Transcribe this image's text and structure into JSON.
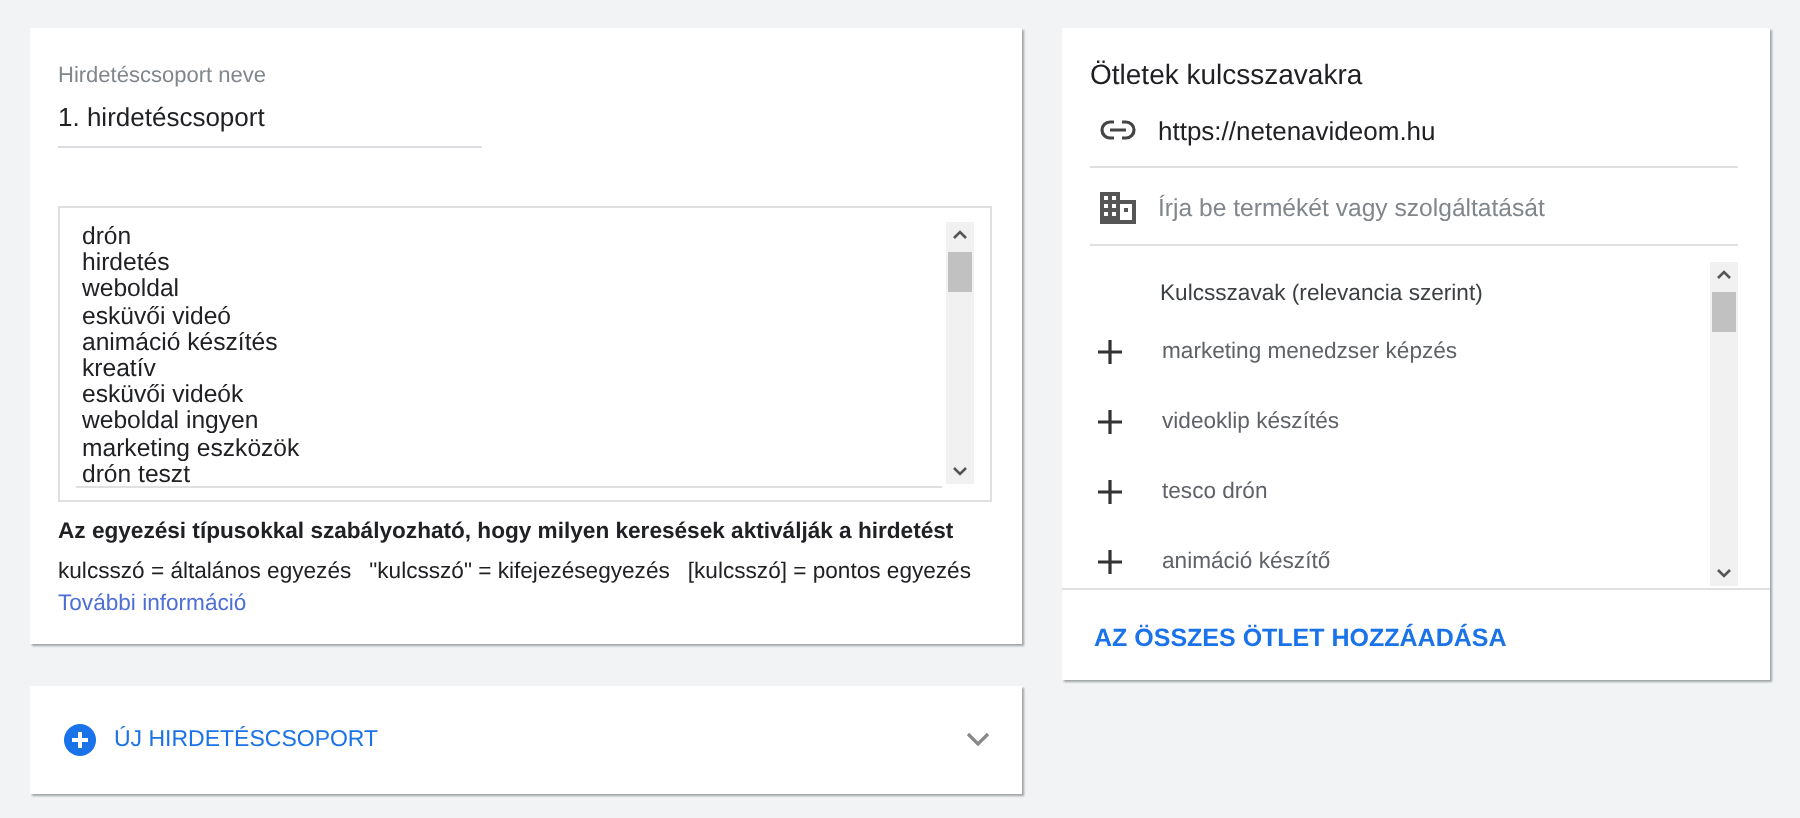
{
  "ad_group": {
    "name_label": "Hirdetéscsoport neve",
    "name_value": "1. hirdetéscsoport",
    "keywords": [
      "drón",
      "hirdetés",
      "weboldal",
      "esküvői videó",
      "animáció készítés",
      "kreatív",
      "esküvői videók",
      "weboldal ingyen",
      "marketing eszközök",
      "drón teszt"
    ],
    "match_info": {
      "heading": "Az egyezési típusokkal szabályozható, hogy milyen keresések aktiválják a hirdetést",
      "types": [
        "kulcsszó = általános egyezés",
        "\"kulcsszó\" = kifejezésegyezés",
        "[kulcsszó] = pontos egyezés"
      ],
      "link": "További információ"
    }
  },
  "new_group": {
    "label": "ÚJ HIRDETÉSCSOPORT",
    "expanded": false
  },
  "ideas": {
    "title": "Ötletek kulcsszavakra",
    "url": "https://netenavideom.hu",
    "product_placeholder": "Írja be termékét vagy szolgáltatását",
    "list_header": "Kulcsszavak (relevancia szerint)",
    "suggestions": [
      "marketing menedzser képzés",
      "videoklip készítés",
      "tesco drón",
      "animáció készítő"
    ],
    "add_all_button": "AZ ÖSSZES ÖTLET HOZZÁADÁSA"
  }
}
